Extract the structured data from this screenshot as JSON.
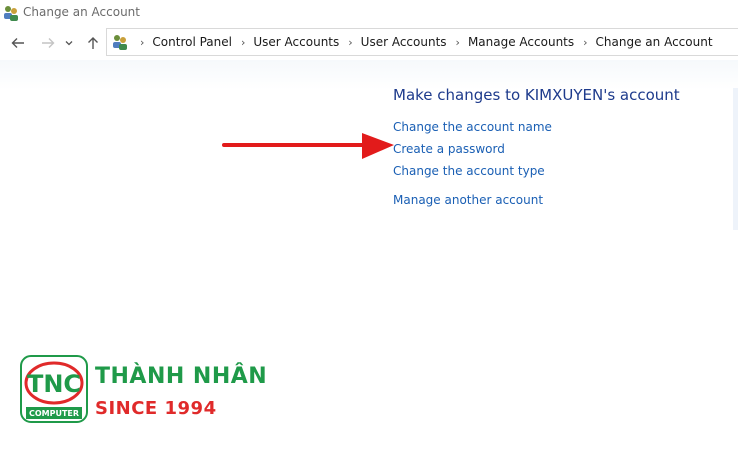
{
  "window": {
    "title": "Change an Account"
  },
  "nav": {
    "breadcrumbs": [
      "Control Panel",
      "User Accounts",
      "User Accounts",
      "Manage Accounts",
      "Change an Account"
    ]
  },
  "main": {
    "heading": "Make changes to KIMXUYEN's account",
    "links": [
      "Change the account name",
      "Create a password",
      "Change the account type",
      "Manage another account"
    ]
  },
  "watermark": {
    "logo_text": "TNC",
    "logo_subtext": "COMPUTER",
    "brand_name": "THÀNH NHÂN",
    "since": "SINCE 1994"
  },
  "colors": {
    "link": "#1a5fb4",
    "heading": "#1e3b8c",
    "arrow": "#e21b1b",
    "brand_green": "#1f9a49",
    "brand_red": "#e02a2a"
  }
}
